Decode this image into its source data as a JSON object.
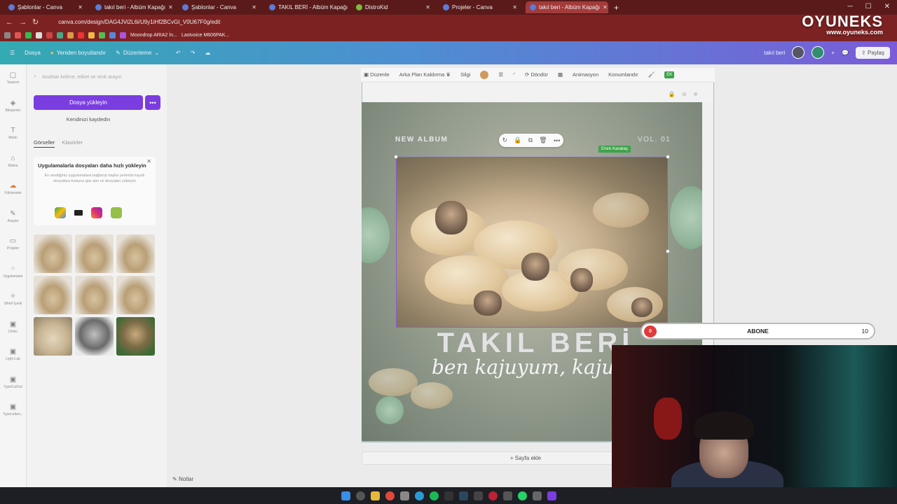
{
  "browser": {
    "tabs": [
      {
        "title": "Şablonlar - Canva",
        "active": false
      },
      {
        "title": "takıl beri - Albüm Kapağı",
        "active": false
      },
      {
        "title": "Şablonlar - Canva",
        "active": false
      },
      {
        "title": "TAKIL BERİ - Albüm Kapağı",
        "active": false
      },
      {
        "title": "DistroKid",
        "active": false
      },
      {
        "title": "Projeler - Canva",
        "active": false
      },
      {
        "title": "takıl beri - Albüm Kapağı",
        "active": true
      }
    ],
    "url": "canva.com/design/DAG4JVi2L6i/U9y1iHf2BCvGt_V0U67F0g/edit",
    "bookmarks": [
      "Moondrop ARIA2 İn...",
      "Lastvoice M606PAK..."
    ]
  },
  "overlay_brand": {
    "name": "OYUNEKS",
    "site": "www.oyuneks.com"
  },
  "header": {
    "file": "Dosya",
    "resize": "Yeniden boyutlandır",
    "edit": "Düzenleme",
    "doc_title": "takıl beri",
    "share": "Paylaş"
  },
  "rail": [
    {
      "label": "Tasarım",
      "icon": "layout-icon"
    },
    {
      "label": "Bileşenler",
      "icon": "elements-icon"
    },
    {
      "label": "Metin",
      "icon": "text-icon"
    },
    {
      "label": "Marka",
      "icon": "brand-icon"
    },
    {
      "label": "Yüklemeler",
      "icon": "upload-icon"
    },
    {
      "label": "Araçlar",
      "icon": "tools-icon"
    },
    {
      "label": "Projeler",
      "icon": "folder-icon"
    },
    {
      "label": "Uygulamalar",
      "icon": "apps-icon"
    },
    {
      "label": "Sihirli İçerik",
      "icon": "magic-icon"
    },
    {
      "label": "Dinko",
      "icon": "app-icon"
    },
    {
      "label": "Light Lab",
      "icon": "app-icon"
    },
    {
      "label": "TypeCutOut",
      "icon": "app-icon"
    },
    {
      "label": "TypeLetteri...",
      "icon": "app-icon"
    }
  ],
  "panel": {
    "search_placeholder": "Anahtar kelime, etiket ve renk arayın",
    "upload_button": "Dosya yükleyin",
    "record_button": "Kendinizi kaydedin",
    "tabs": [
      "Görseller",
      "Klasörler"
    ],
    "promo_title": "Uygulamalarla dosyaları daha hızlı yükleyin",
    "promo_text": "En sevdiğiniz uygulamalara bağlanıp başka yerlerde kayıtlı dosyalara kolayca göz atın ve dosyaları yükleyin",
    "notes": "Notlar"
  },
  "toolbar": {
    "edit": "Düzenle",
    "bg_remove": "Arka Plan Kaldırma",
    "erase": "Silgi",
    "rotate": "Döndür",
    "animate": "Animasyon",
    "position": "Konumlandır",
    "badge": "EK"
  },
  "canvas": {
    "new_album": "NEW ALBUM",
    "vol": "VOL. 01",
    "collaborator": "Emre Karakaş",
    "title": "TAKIL BERİ",
    "subtitle": "ben kajuyum, kaju",
    "add_page": "+ Sayfa ekle"
  },
  "subscriber_bar": {
    "label": "ABONE",
    "current": "0",
    "goal": "10",
    "progress": 0.0
  },
  "colors": {
    "accent": "#7a3de0",
    "header_start": "#34aab2",
    "header_end": "#7a5cd8",
    "browser": "#7d2222"
  }
}
